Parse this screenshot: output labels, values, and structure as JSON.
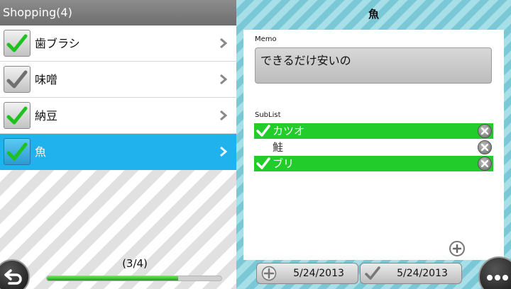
{
  "left": {
    "title": "Shopping(4)",
    "items": [
      {
        "label": "歯ブラシ",
        "checked": true
      },
      {
        "label": "味噌",
        "checked": false
      },
      {
        "label": "納豆",
        "checked": true
      },
      {
        "label": "魚",
        "checked": true,
        "selected": true
      }
    ],
    "progress_text": "(3/4)",
    "progress_fraction": 0.75
  },
  "right": {
    "title": "魚",
    "memo_label": "Memo",
    "memo_text": "できるだけ安いの",
    "sublist_label": "SubList",
    "sublist": [
      {
        "label": "カツオ",
        "checked": true
      },
      {
        "label": "鮭",
        "checked": false
      },
      {
        "label": "ブリ",
        "checked": true
      }
    ],
    "created_date": "5/24/2013",
    "checked_date": "5/24/2013"
  },
  "colors": {
    "selected_row": "#1fb2ec",
    "check_green": "#21cc2b",
    "progress_green": "#1aa314",
    "right_bg": "#a7dfe8"
  },
  "icons": [
    "back-arrow-icon",
    "checkmark-icon",
    "chevron-right-icon",
    "delete-x-icon",
    "plus-icon",
    "more-dots-icon"
  ]
}
